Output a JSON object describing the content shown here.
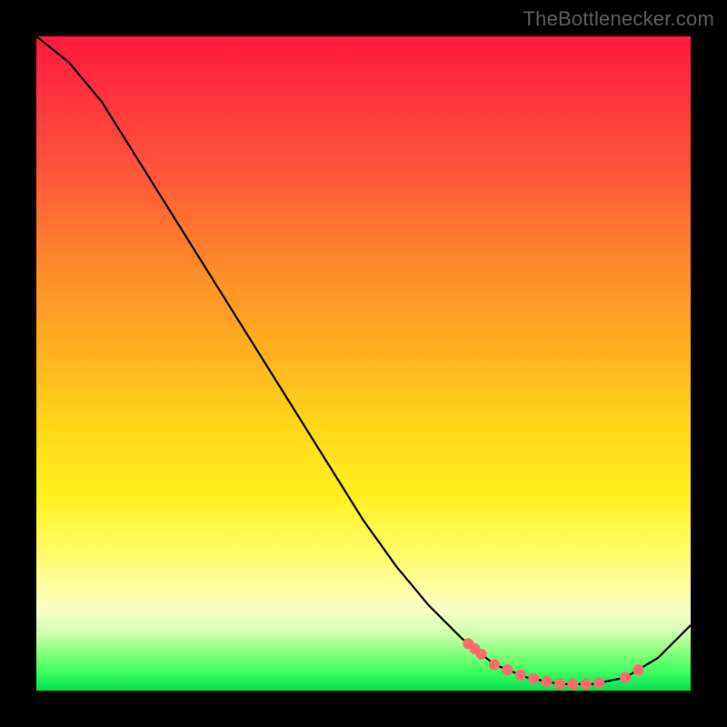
{
  "attribution": "TheBottlenecker.com",
  "chart_data": {
    "type": "line",
    "title": "",
    "xlabel": "",
    "ylabel": "",
    "x": [
      0.0,
      0.05,
      0.1,
      0.15,
      0.2,
      0.25,
      0.3,
      0.35,
      0.4,
      0.45,
      0.5,
      0.55,
      0.6,
      0.65,
      0.7,
      0.75,
      0.8,
      0.85,
      0.9,
      0.95,
      1.0
    ],
    "series": [
      {
        "name": "curve",
        "values": [
          1.0,
          0.96,
          0.9,
          0.82,
          0.74,
          0.66,
          0.58,
          0.5,
          0.42,
          0.34,
          0.26,
          0.19,
          0.13,
          0.08,
          0.04,
          0.02,
          0.01,
          0.01,
          0.02,
          0.05,
          0.1
        ]
      }
    ],
    "highlight_points_x": [
      0.66,
      0.67,
      0.68,
      0.7,
      0.72,
      0.74,
      0.76,
      0.78,
      0.8,
      0.82,
      0.84,
      0.86,
      0.9,
      0.92
    ],
    "xlim": [
      0,
      1
    ],
    "ylim": [
      0,
      1
    ],
    "background_gradient": {
      "top": "#ff1a3a",
      "mid": "#ffe020",
      "bottom": "#00e050"
    },
    "curve_color": "#000000",
    "point_color": "#ff6b6b"
  }
}
